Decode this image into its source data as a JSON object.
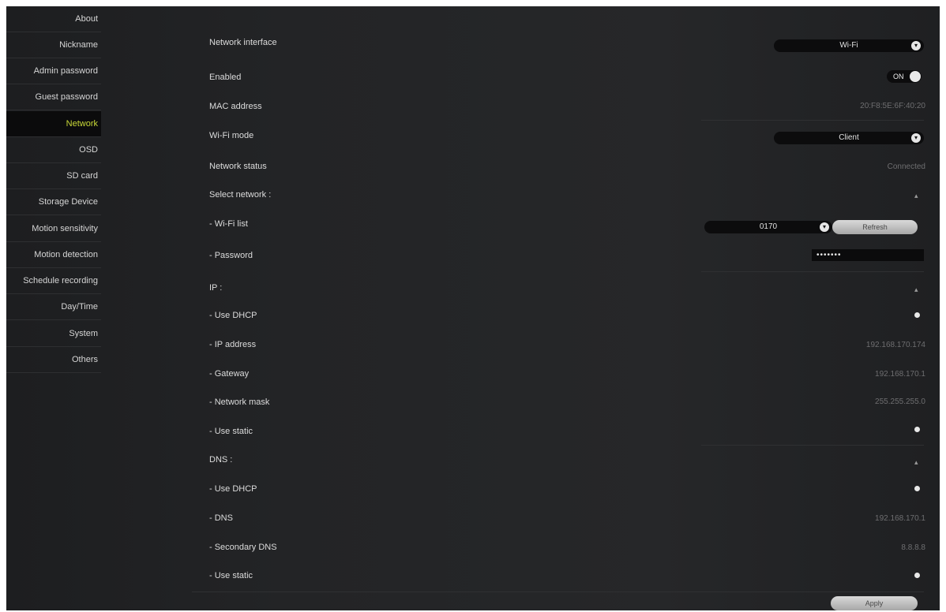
{
  "sidebar": {
    "items": [
      {
        "label": "About"
      },
      {
        "label": "Nickname"
      },
      {
        "label": "Admin password"
      },
      {
        "label": "Guest password"
      },
      {
        "label": "Network"
      },
      {
        "label": "OSD"
      },
      {
        "label": "SD card"
      },
      {
        "label": "Storage Device"
      },
      {
        "label": "Motion sensitivity"
      },
      {
        "label": "Motion detection"
      },
      {
        "label": "Schedule recording"
      },
      {
        "label": "Day/Time"
      },
      {
        "label": "System"
      },
      {
        "label": "Others"
      }
    ],
    "active_index": 4
  },
  "network": {
    "interface_label": "Network interface",
    "interface_value": "Wi-Fi",
    "enabled_label": "Enabled",
    "enabled_value": "ON",
    "mac_label": "MAC address",
    "mac_value": "20:F8:5E:6F:40:20",
    "wifi_mode_label": "Wi-Fi mode",
    "wifi_mode_value": "Client",
    "status_label": "Network status",
    "status_value": "Connected",
    "select_network_label": "Select network :",
    "wifi_list_label": "- Wi-Fi list",
    "wifi_list_value": "0170",
    "refresh_label": "Refresh",
    "password_label": "- Password",
    "password_value": "•••••••",
    "ip_label": "IP :",
    "ip_use_dhcp_label": "- Use DHCP",
    "ip_address_label": "- IP address",
    "ip_address_value": "192.168.170.174",
    "gateway_label": "- Gateway",
    "gateway_value": "192.168.170.1",
    "mask_label": "- Network mask",
    "mask_value": "255.255.255.0",
    "ip_use_static_label": "- Use static",
    "dns_label": "DNS :",
    "dns_use_dhcp_label": "- Use DHCP",
    "dns_primary_label": "- DNS",
    "dns_primary_value": "192.168.170.1",
    "dns_secondary_label": "- Secondary DNS",
    "dns_secondary_value": "8.8.8.8",
    "dns_use_static_label": "- Use static",
    "apply_label": "Apply"
  },
  "colors": {
    "accent": "#c9d938",
    "background": "#232426",
    "active_item_bg": "#0b0b0c"
  }
}
